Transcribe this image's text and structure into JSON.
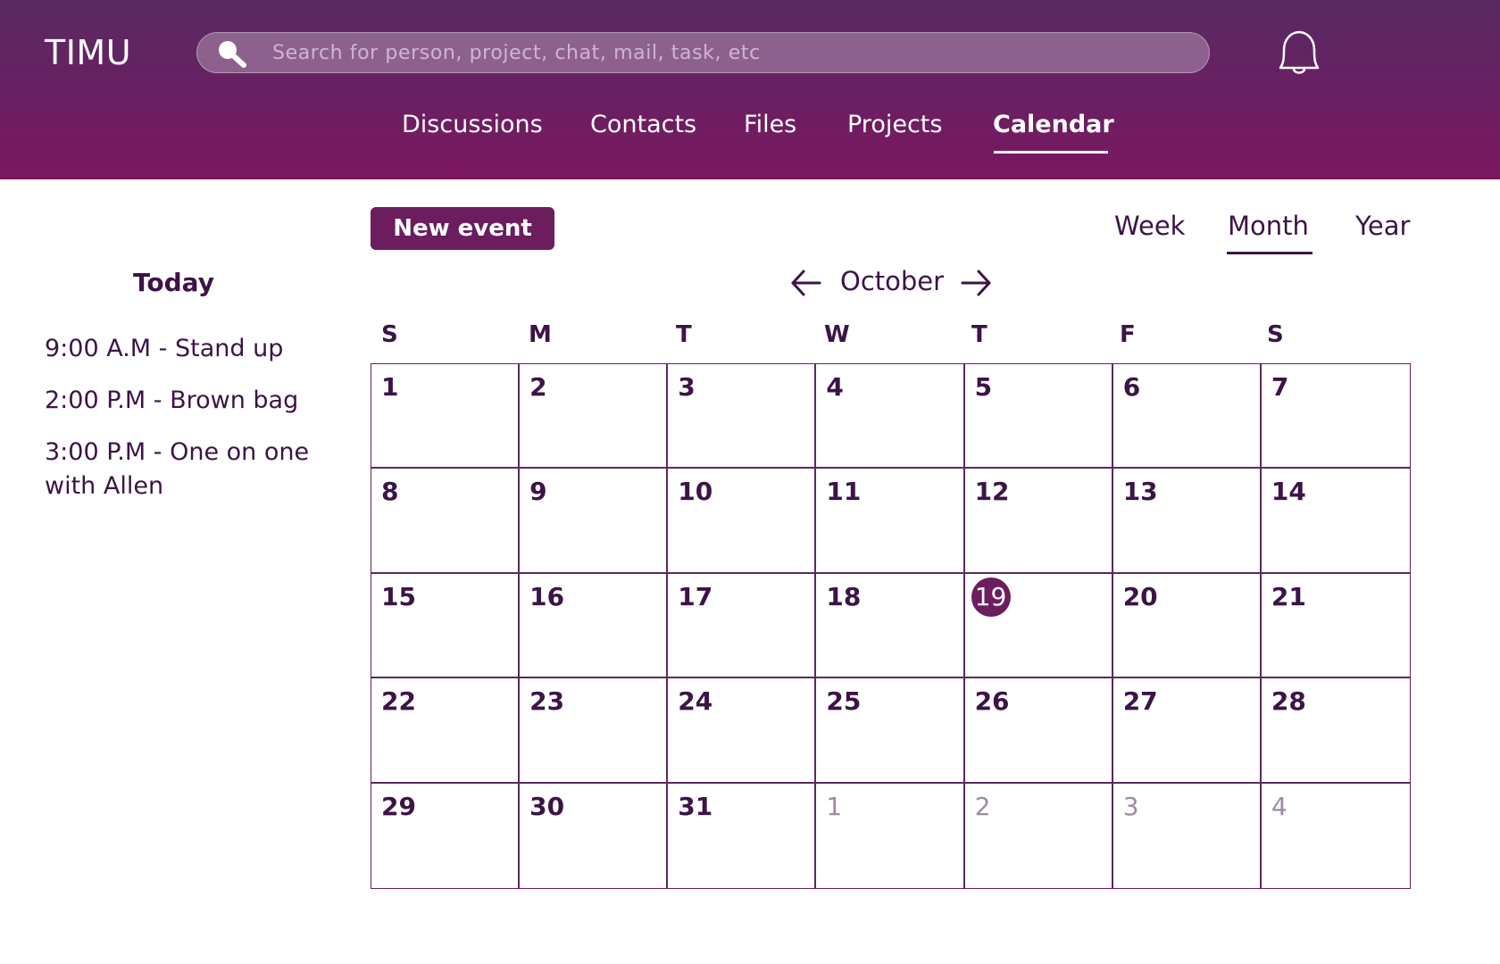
{
  "app": {
    "logo": "TIMU"
  },
  "search": {
    "placeholder": "Search for person, project, chat, mail, task, etc"
  },
  "nav": {
    "items": [
      {
        "label": "Discussions"
      },
      {
        "label": "Contacts"
      },
      {
        "label": "Files"
      },
      {
        "label": "Projects"
      },
      {
        "label": "Calendar",
        "active": true
      }
    ]
  },
  "sidebar": {
    "title": "Today",
    "events": [
      {
        "text": "9:00 A.M - Stand up"
      },
      {
        "text": "2:00 P.M - Brown bag"
      },
      {
        "text": "3:00 P.M - One on one with Allen"
      }
    ]
  },
  "toolbar": {
    "new_event_label": "New event",
    "views": [
      {
        "label": "Week"
      },
      {
        "label": "Month",
        "active": true
      },
      {
        "label": "Year"
      }
    ]
  },
  "calendar": {
    "month": "October",
    "weekdays": [
      "S",
      "M",
      "T",
      "W",
      "T",
      "F",
      "S"
    ],
    "days": [
      {
        "n": "1"
      },
      {
        "n": "2"
      },
      {
        "n": "3"
      },
      {
        "n": "4"
      },
      {
        "n": "5"
      },
      {
        "n": "6"
      },
      {
        "n": "7"
      },
      {
        "n": "8"
      },
      {
        "n": "9"
      },
      {
        "n": "10"
      },
      {
        "n": "11"
      },
      {
        "n": "12"
      },
      {
        "n": "13"
      },
      {
        "n": "14"
      },
      {
        "n": "15"
      },
      {
        "n": "16"
      },
      {
        "n": "17"
      },
      {
        "n": "18"
      },
      {
        "n": "19",
        "today": true
      },
      {
        "n": "20"
      },
      {
        "n": "21"
      },
      {
        "n": "22"
      },
      {
        "n": "23"
      },
      {
        "n": "24"
      },
      {
        "n": "25"
      },
      {
        "n": "26"
      },
      {
        "n": "27"
      },
      {
        "n": "28"
      },
      {
        "n": "29"
      },
      {
        "n": "30"
      },
      {
        "n": "31"
      },
      {
        "n": "1",
        "other": true
      },
      {
        "n": "2",
        "other": true
      },
      {
        "n": "3",
        "other": true
      },
      {
        "n": "4",
        "other": true
      }
    ]
  },
  "colors": {
    "brand": "#6b1d5e",
    "header_top": "#582a62",
    "header_bottom": "#7c175f",
    "text": "#3c1447",
    "muted_day": "#9b8aa5"
  }
}
